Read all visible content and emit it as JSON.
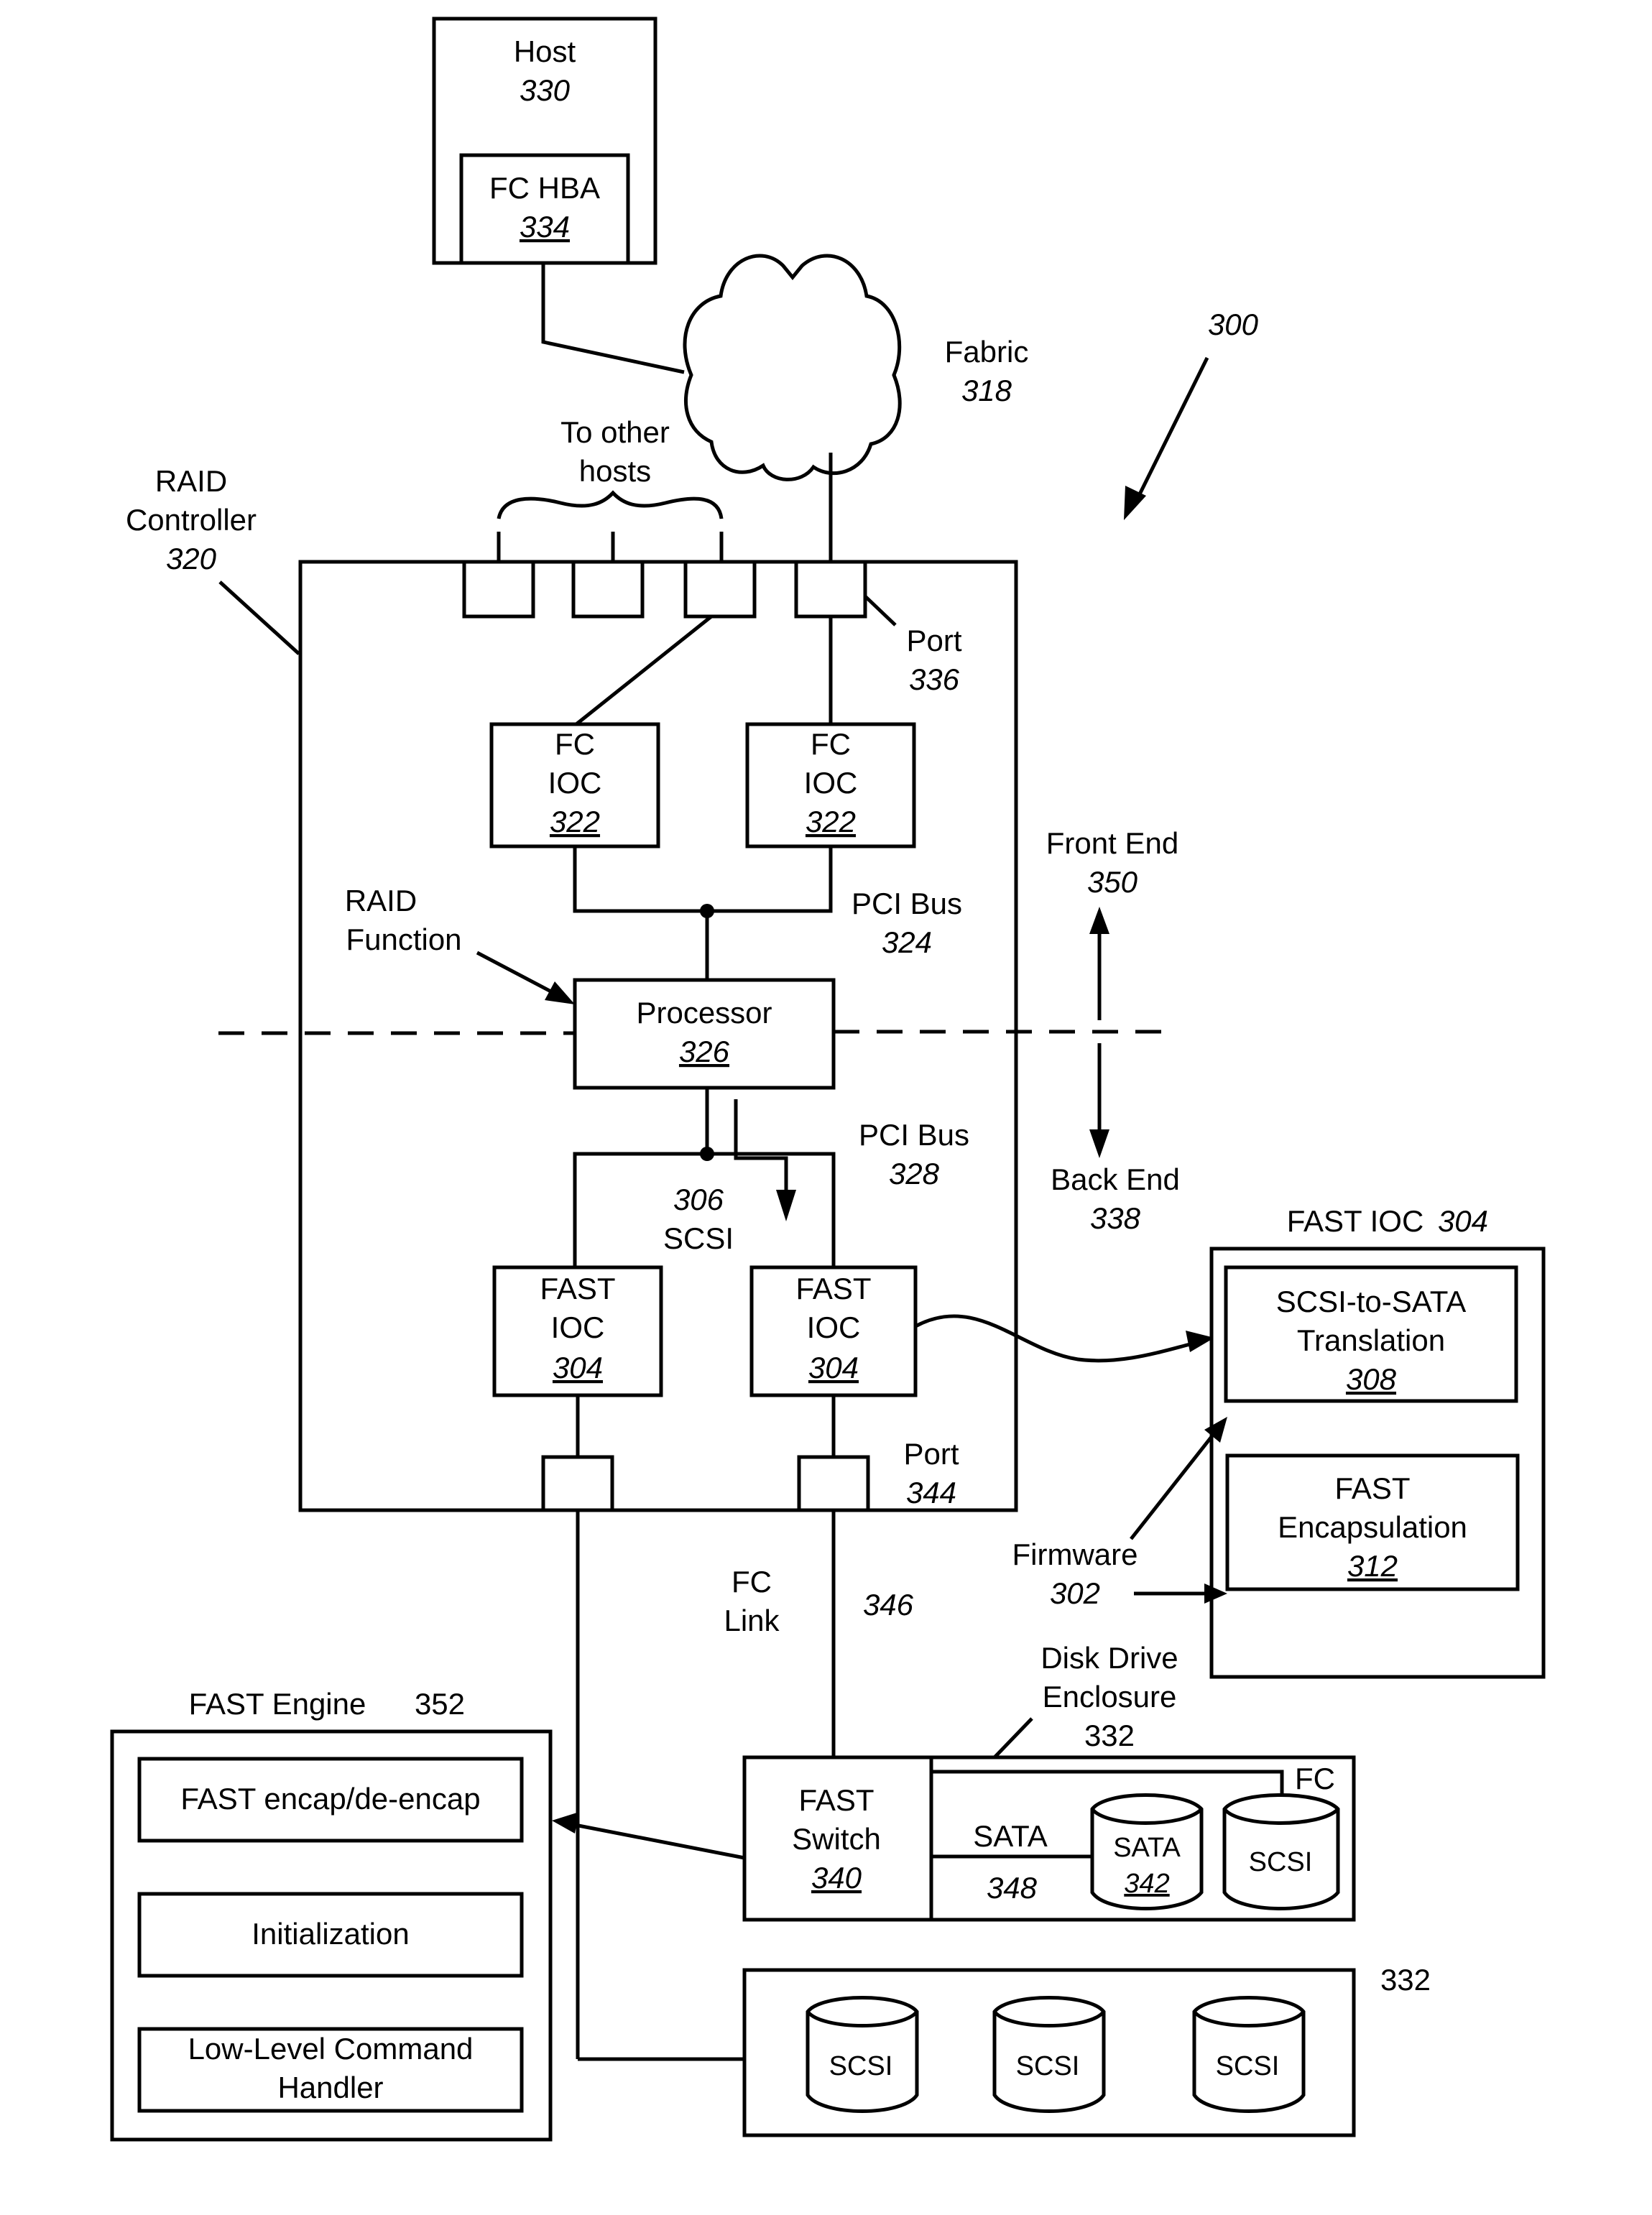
{
  "figure": {
    "number": "300",
    "host": {
      "label": "Host",
      "number": "330"
    },
    "fc_hba": {
      "label": "FC HBA",
      "number": "334"
    },
    "fabric": {
      "label": "Fabric",
      "number": "318"
    },
    "to_other_hosts": {
      "line1": "To other",
      "line2": "hosts"
    },
    "raid_controller": {
      "line1": "RAID",
      "line2": "Controller",
      "number": "320"
    },
    "port_336": {
      "label": "Port",
      "number": "336"
    },
    "fc_ioc_left": {
      "line1": "FC",
      "line2": "IOC",
      "number": "322"
    },
    "fc_ioc_right": {
      "line1": "FC",
      "line2": "IOC",
      "number": "322"
    },
    "pci_bus_324": {
      "label": "PCI Bus",
      "number": "324"
    },
    "raid_function": {
      "line1": "RAID",
      "line2": "Function"
    },
    "processor": {
      "label": "Processor",
      "number": "326"
    },
    "front_end": {
      "label": "Front End",
      "number": "350"
    },
    "back_end": {
      "label": "Back End",
      "number": "338"
    },
    "pci_bus_328": {
      "label": "PCI Bus",
      "number": "328"
    },
    "scsi_306": {
      "number": "306",
      "label": "SCSI"
    },
    "fast_ioc_left": {
      "line1": "FAST",
      "line2": "IOC",
      "number": "304"
    },
    "fast_ioc_right": {
      "line1": "FAST",
      "line2": "IOC",
      "number": "304"
    },
    "port_344": {
      "label": "Port",
      "number": "344"
    },
    "fast_ioc_detail": {
      "title": "FAST IOC",
      "number": "304",
      "translation": {
        "line1": "SCSI-to-SATA",
        "line2": "Translation",
        "number": "308"
      },
      "encapsulation": {
        "line1": "FAST",
        "line2": "Encapsulation",
        "number": "312"
      }
    },
    "firmware": {
      "label": "Firmware",
      "number": "302"
    },
    "fc_link": {
      "line1": "FC",
      "line2": "Link",
      "number": "346"
    },
    "disk_enclosure": {
      "line1": "Disk Drive",
      "line2": "Enclosure",
      "number": "332"
    },
    "fast_switch": {
      "line1": "FAST",
      "line2": "Switch",
      "number": "340"
    },
    "fc_label": "FC",
    "sata_link": {
      "label": "SATA",
      "number": "348"
    },
    "sata_disk": {
      "label": "SATA",
      "number": "342"
    },
    "scsi_disk_label": "SCSI",
    "fast_engine": {
      "title": "FAST Engine",
      "number": "352",
      "items": [
        {
          "line1": "FAST encap/de-encap"
        },
        {
          "line1": "Initialization"
        },
        {
          "line1": "Low-Level Command",
          "line2": "Handler"
        }
      ]
    },
    "enclosure_2": {
      "number": "332",
      "disks": [
        "SCSI",
        "SCSI",
        "SCSI"
      ]
    }
  }
}
